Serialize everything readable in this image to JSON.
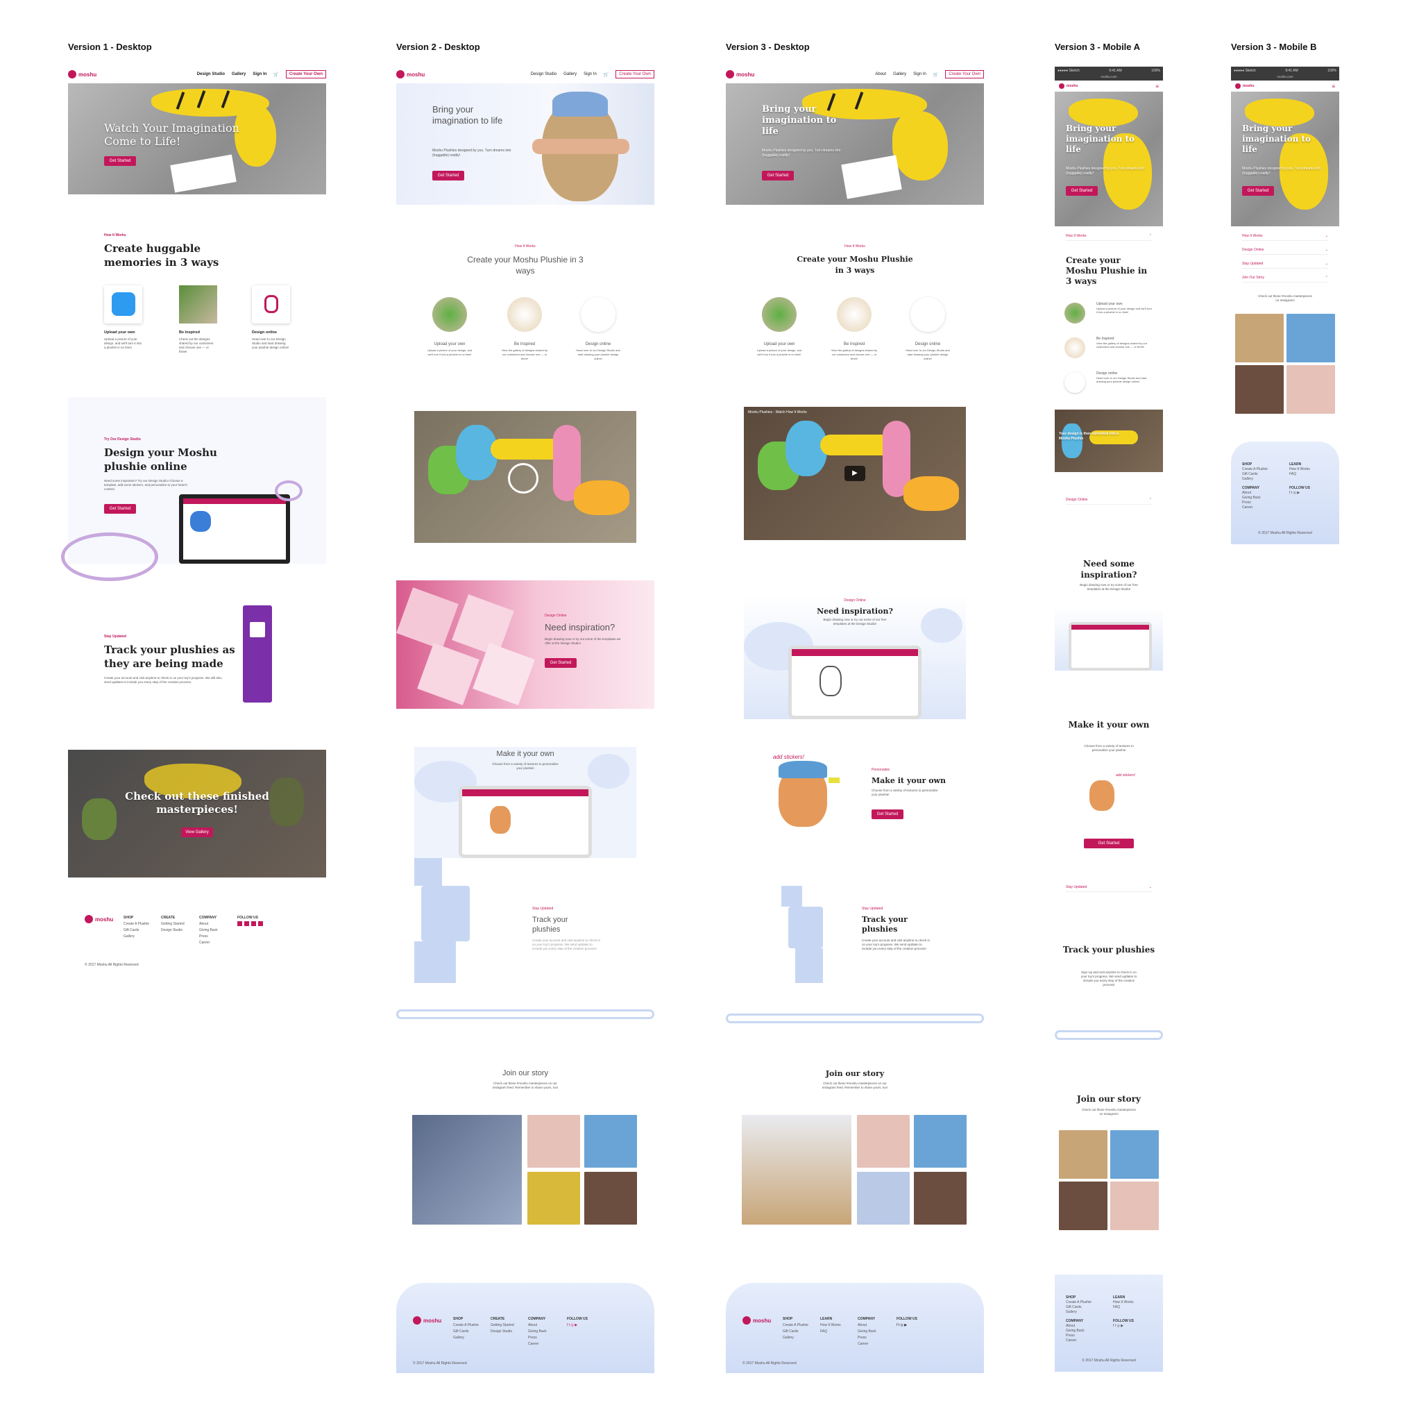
{
  "columns": [
    {
      "title": "Version 1 - Desktop"
    },
    {
      "title": "Version 2 - Desktop"
    },
    {
      "title": "Version 3 - Desktop"
    },
    {
      "title": "Version 3 - Mobile A"
    },
    {
      "title": "Version 3 - Mobile B"
    }
  ],
  "brand": {
    "logo": "moshu",
    "accent": "#c2185b",
    "blue_accent": "#dce6f8"
  },
  "v1": {
    "nav": [
      "Design Studio",
      "Gallery",
      "Sign In"
    ],
    "nav_cta": "Create Your Own",
    "hero_title": "Watch Your Imagination Come to Life!",
    "hero_btn": "Get Started",
    "how_label": "How It Works",
    "how_title": "Create huggable memories in 3 ways",
    "ways": [
      {
        "title": "Upload your own",
        "text": "Upload a picture of your design, and we'll turn it into a plushie in no time!"
      },
      {
        "title": "Be Inspired",
        "text": "Check out the designs shared by our customers and choose one — or three!"
      },
      {
        "title": "Design online",
        "text": "Head over to our Design Studio and start drawing your plushie design online!"
      }
    ],
    "studio_label": "Try Our Design Studio",
    "studio_title": "Design your Moshu plushie online",
    "studio_text": "Need some inspiration? Try our Design Studio! Choose a template, add some stickers, and personalize to your heart's content.",
    "studio_btn": "Get Started",
    "updated_label": "Stay Updated",
    "updated_title": "Track your plushies as they are being made",
    "updated_text": "Create your account and visit anytime to check in on your toy's progress. We will also send updates to include you every step of the creation process.",
    "gallery_title": "Check out these finished masterpieces!",
    "gallery_btn": "View Gallery",
    "footer": {
      "shop": [
        "SHOP",
        "Create A Plushie",
        "Gift Cards",
        "Gallery"
      ],
      "create": [
        "CREATE",
        "Getting Started",
        "Design Studio"
      ],
      "company": [
        "COMPANY",
        "About",
        "Giving Back",
        "Press",
        "Career"
      ],
      "follow": "FOLLOW US",
      "copyright": "© 2017 Moshu All Rights Reserved"
    }
  },
  "v2": {
    "nav": [
      "Design Studio",
      "Gallery",
      "Sign In"
    ],
    "nav_cta": "Create Your Own",
    "hero_title": "Bring your imagination to life",
    "hero_text": "Moshu Plushies designed by you. Turn dreams into (huggable) reality!",
    "hero_btn": "Get Started",
    "how_label": "How It Works",
    "how_title": "Create your Moshu Plushie in 3 ways",
    "ways": [
      {
        "title": "Upload your own",
        "text": "Upload a picture of your design, and we'll turn it into a plushie in no time!"
      },
      {
        "title": "Be Inspired",
        "text": "View the gallery of designs shared by our customers and choose one — or three!"
      },
      {
        "title": "Design online",
        "text": "Head over to our Design Studio and start drawing your plushie design online!"
      }
    ],
    "design_label": "Design Online",
    "design_title": "Need inspiration?",
    "design_text": "Begin drawing now or try out some of the templates we offer at the Design Studio!",
    "design_btn": "Get Started",
    "make_title": "Make it your own",
    "make_text": "Choose from a variety of textures to personalize your plushie!",
    "track_label": "Stay Updated",
    "track_title": "Track your plushies",
    "track_text": "Create your account and visit anytime to check in on your toy's progress. We send updates to include you every step of the creation process!",
    "join_title": "Join our story",
    "join_text": "Check out these #moshu masterpieces on our Instagram feed. Remember to share yours, too!",
    "footer": {
      "shop": [
        "SHOP",
        "Create A Plushie",
        "Gift Cards",
        "Gallery"
      ],
      "create": [
        "CREATE",
        "Getting Started",
        "Design Studio"
      ],
      "company": [
        "COMPANY",
        "About",
        "Giving Back",
        "Press",
        "Career"
      ],
      "follow": "FOLLOW US",
      "copyright": "© 2017 Moshu All Rights Reserved"
    }
  },
  "v3": {
    "nav": [
      "About",
      "Gallery",
      "Sign In"
    ],
    "nav_cta": "Create Your Own",
    "hero_title": "Bring your imagination to life",
    "hero_text": "Moshu Plushies designed by you. Turn dreams into (huggable) reality!",
    "hero_btn": "Get Started",
    "how_label": "How It Works",
    "how_title": "Create your Moshu Plushie in 3 ways",
    "ways": [
      {
        "title": "Upload your own",
        "text": "Upload a picture of your design, and we'll turn it into a plushie in no time!"
      },
      {
        "title": "Be Inspired",
        "text": "View the gallery of designs shared by our customers and choose one — or three!"
      },
      {
        "title": "Design online",
        "text": "Head over to our Design Studio and start drawing your plushie design online!"
      }
    ],
    "video_label": "Moshu Plushies - Watch How It Works",
    "design_label": "Design Online",
    "design_title": "Need inspiration?",
    "design_text": "Begin drawing now or try out some of our free templates at the Design Studio!",
    "sticker": "add stickers!",
    "make_label": "Personalize",
    "make_title": "Make it your own",
    "make_text": "Choose from a variety of textures to personalize your plushie!",
    "make_btn": "Get Started",
    "track_label": "Stay Updated",
    "track_title": "Track your plushies",
    "track_text": "Create your account and visit anytime to check in on your toy's progress. We send updates to include you every step of the creation process!",
    "join_title": "Join our story",
    "join_text": "Check out these #moshu masterpieces on our Instagram feed. Remember to share yours, too!",
    "footer": {
      "shop": [
        "SHOP",
        "Create A Plushie",
        "Gift Cards",
        "Gallery"
      ],
      "learn": [
        "LEARN",
        "How It Works",
        "FAQ"
      ],
      "company": [
        "COMPANY",
        "About",
        "Giving Back",
        "Press",
        "Career"
      ],
      "follow": "FOLLOW US",
      "copyright": "© 2017 Moshu All Rights Reserved"
    }
  },
  "mobileA": {
    "status_left": "●●●●● Sketch",
    "status_time": "9:41 AM",
    "status_right": "100%",
    "url": "moshu.com",
    "hero_title": "Bring your imagination to life",
    "hero_text": "Moshu Plushies designed by you. Turn dreams into (huggable) reality!",
    "hero_btn": "Get Started",
    "acc_how": "How It Works",
    "how_title": "Create your Moshu Plushie in 3 ways",
    "ways": [
      {
        "title": "Upload your own",
        "text": "Upload a picture of your design and we'll turn it into a plushie in no time!"
      },
      {
        "title": "Be Inspired",
        "text": "View the gallery of designs shared by our customers and choose one — or three!"
      },
      {
        "title": "Design online",
        "text": "Head over to our Design Studio and start drawing your plushie design online!"
      }
    ],
    "video_caption": "Your design is then converted into a Moshu Plushie",
    "acc_design": "Design Online",
    "insp_title": "Need some inspiration?",
    "insp_text": "Begin drawing now or try some of our free templates at the Design Studio!",
    "make_title": "Make it your own",
    "make_text": "Choose from a variety of textures to personalize your plushie",
    "sticker": "add stickers!",
    "make_btn": "Get Started",
    "acc_updated": "Stay Updated",
    "track_title": "Track your plushies",
    "track_text": "Sign Up and visit anytime to check in on your toy's progress. We send updates to include you every step of the creation process!",
    "join_title": "Join our story",
    "join_text": "Check out these #moshu masterpieces on Instagram!",
    "footer": {
      "shop": [
        "SHOP",
        "Create A Plushie",
        "Gift Cards",
        "Gallery"
      ],
      "learn": [
        "LEARN",
        "How It Works",
        "FAQ"
      ],
      "company": [
        "COMPANY",
        "About",
        "Giving Back",
        "Press",
        "Career"
      ],
      "follow": "FOLLOW US",
      "copyright": "© 2017 Moshu All Rights Reserved"
    }
  },
  "mobileB": {
    "status_left": "●●●●● Sketch",
    "status_time": "9:41 AM",
    "status_right": "100%",
    "url": "moshu.com",
    "hero_title": "Bring your imagination to life",
    "hero_text": "Moshu Plushies designed by you. Turn dreams into (huggable) reality!",
    "hero_btn": "Get Started",
    "accordion": [
      "How It Works",
      "Design Online",
      "Stay Updated",
      "Join Our Story"
    ],
    "insta_text": "Check out these #moshu masterpieces on Instagram!",
    "footer": {
      "shop": [
        "SHOP",
        "Create A Plushie",
        "Gift Cards",
        "Gallery"
      ],
      "learn": [
        "LEARN",
        "How It Works",
        "FAQ"
      ],
      "company": [
        "COMPANY",
        "About",
        "Giving Back",
        "Press",
        "Career"
      ],
      "follow": "FOLLOW US",
      "copyright": "© 2017 Moshu All Rights Reserved"
    }
  }
}
